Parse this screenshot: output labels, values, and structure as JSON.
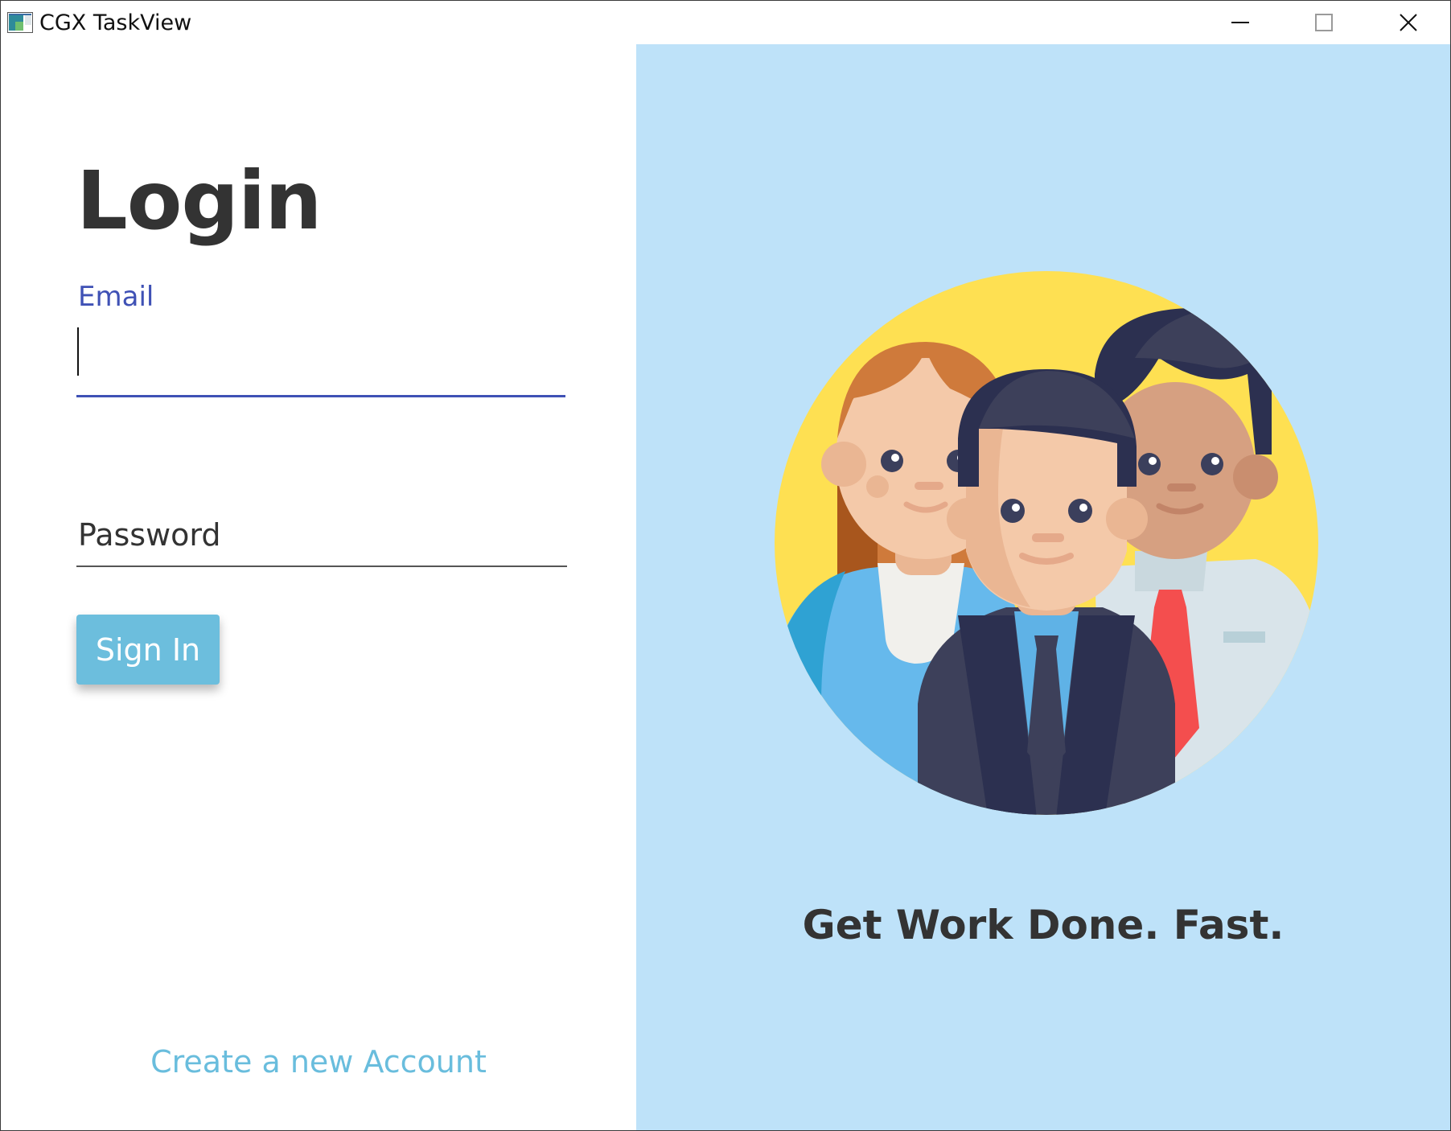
{
  "window": {
    "title": "CGX TaskView",
    "icon": "app-window-icon",
    "controls": [
      "minimize-icon",
      "maximize-icon",
      "close-icon"
    ]
  },
  "login": {
    "heading": "Login",
    "email_label": "Email",
    "email_value": "",
    "password_placeholder": "Password",
    "signin_label": "Sign In",
    "create_account_label": "Create a new Account"
  },
  "hero": {
    "tagline": "Get Work Done. Fast.",
    "illustration": "team-people-illustration"
  },
  "colors": {
    "accent": "#3f51b5",
    "button": "#6cbedd",
    "link": "#69bddd",
    "hero_background": "#bee2f9",
    "circle": "#fee052"
  }
}
